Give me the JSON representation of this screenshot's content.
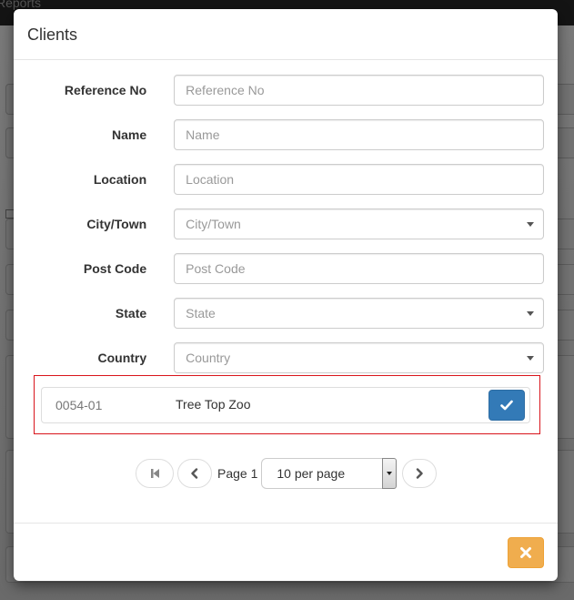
{
  "background": {
    "topbar_label": "Reports"
  },
  "modal": {
    "title": "Clients",
    "fields": [
      {
        "label": "Reference No",
        "type": "text",
        "placeholder": "Reference No",
        "value": ""
      },
      {
        "label": "Name",
        "type": "text",
        "placeholder": "Name",
        "value": ""
      },
      {
        "label": "Location",
        "type": "text",
        "placeholder": "Location",
        "value": ""
      },
      {
        "label": "City/Town",
        "type": "select",
        "placeholder": "City/Town",
        "value": ""
      },
      {
        "label": "Post Code",
        "type": "text",
        "placeholder": "Post Code",
        "value": ""
      },
      {
        "label": "State",
        "type": "select",
        "placeholder": "State",
        "value": ""
      },
      {
        "label": "Country",
        "type": "select",
        "placeholder": "Country",
        "value": ""
      }
    ],
    "results": [
      {
        "reference": "0054-01",
        "name": "Tree Top Zoo",
        "action_icon": "check-icon"
      }
    ],
    "pagination": {
      "first_icon": "step-backward-icon",
      "prev_icon": "chevron-left-icon",
      "page_label": "Page 1",
      "per_page_selected": "10 per page",
      "next_icon": "chevron-right-icon"
    },
    "footer": {
      "close_icon": "close-icon"
    }
  },
  "colors": {
    "primary": "#337ab7",
    "warning": "#f0ad4e",
    "highlight_border": "#d9141b"
  }
}
